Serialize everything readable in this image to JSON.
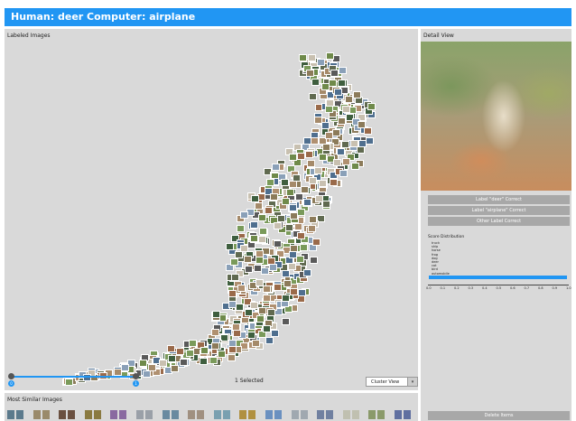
{
  "header": {
    "title": "Human: deer Computer: airplane"
  },
  "left_panel": {
    "title": "Labeled Images",
    "selected_count": "1 Selected",
    "view_mode": "Cluster View",
    "slider_min_label": "0",
    "slider_max_label": "1"
  },
  "bottom_panel": {
    "title": "Most Similar Images",
    "thumbnail_count": 16
  },
  "right_panel": {
    "title": "Detail View",
    "buttons": {
      "label_deer": "Label \"deer\" Correct",
      "label_airplane": "Label \"airplane\" Correct",
      "label_other": "Other Label Correct"
    },
    "delete": "Delete Items"
  },
  "chart_data": {
    "type": "bar",
    "title": "Score Distribution",
    "orientation": "horizontal",
    "categories": [
      "truck",
      "ship",
      "horse",
      "frog",
      "dog",
      "deer",
      "cat",
      "bird",
      "automobile",
      "airplane"
    ],
    "values": [
      0.0,
      0.0,
      0.0,
      0.0,
      0.0,
      0.01,
      0.0,
      0.0,
      0.0,
      0.99
    ],
    "xticks": [
      "0.0",
      "0.1",
      "0.2",
      "0.3",
      "0.4",
      "0.5",
      "0.6",
      "0.7",
      "0.8",
      "0.9",
      "1.0"
    ],
    "xlim": [
      0,
      1
    ]
  },
  "colors": {
    "accent": "#2196f3",
    "panel": "#d9d9d9",
    "button": "#a8a8a8"
  }
}
